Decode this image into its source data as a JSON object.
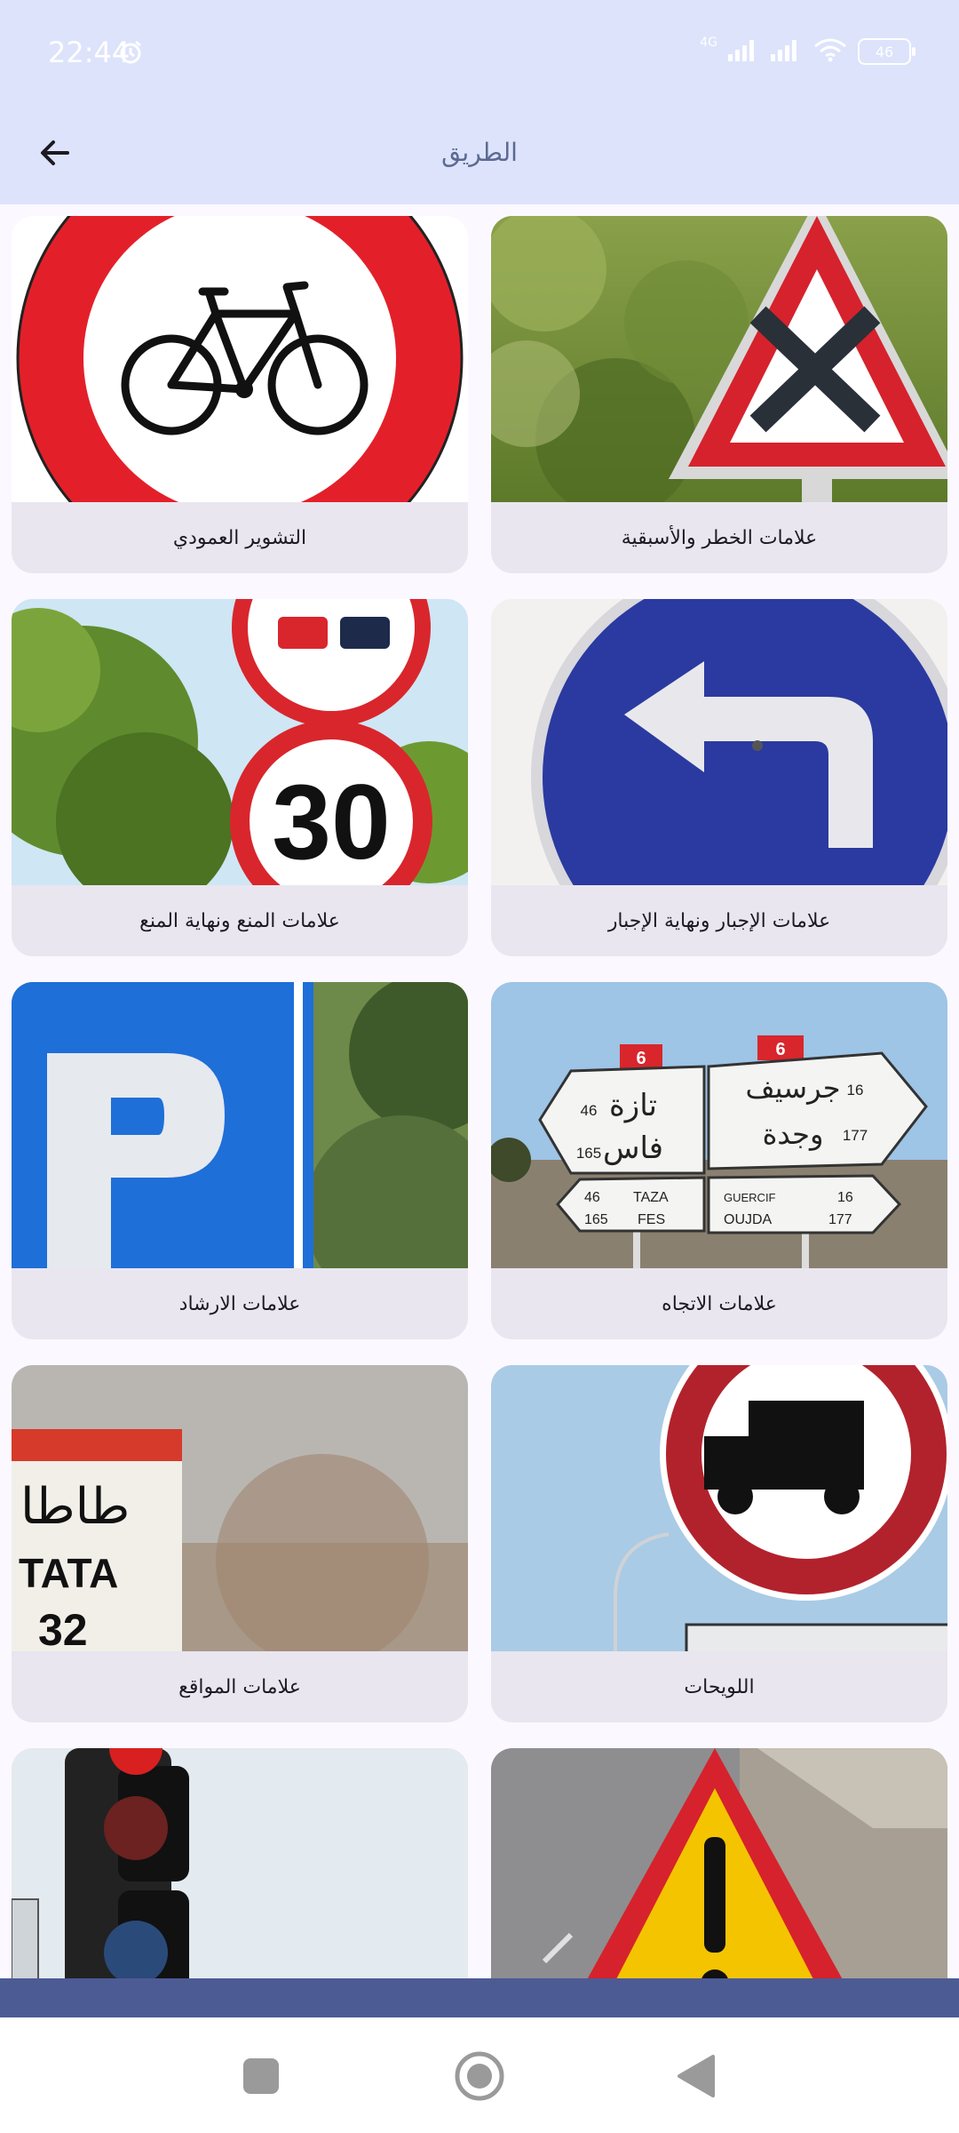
{
  "status_bar": {
    "time": "22:44",
    "network_label": "4G",
    "battery": "46"
  },
  "app_bar": {
    "title": "الطريق"
  },
  "cards": [
    {
      "label": "التشوير العمودي",
      "image": "no-bicycles-sign"
    },
    {
      "label": "علامات الخطر والأسبقية",
      "image": "crossroads-priority-sign"
    },
    {
      "label": "علامات المنع ونهاية المنع",
      "image": "no-overtaking-and-speed-30-signs"
    },
    {
      "label": "علامات الإجبار ونهاية الإجبار",
      "image": "mandatory-turn-left-sign"
    },
    {
      "label": "علامات الارشاد",
      "image": "parking-sign"
    },
    {
      "label": "علامات الاتجاه",
      "image": "direction-signposts"
    },
    {
      "label": "علامات المواقع",
      "image": "location-milestone"
    },
    {
      "label": "اللويحات",
      "image": "no-trucks-sign-with-panel"
    },
    {
      "label": "",
      "image": "traffic-light"
    },
    {
      "label": "",
      "image": "warning-exclamation-sign"
    }
  ],
  "images_text": {
    "speed": "30",
    "dir_route": "6",
    "dir_city_taza_ar": "تازة",
    "dir_city_fes_ar": "فاس",
    "dir_city_guercif_ar": "جرسيف",
    "dir_city_oujda_ar": "وجدة",
    "dir_km_taza": "46",
    "dir_km_fes": "165",
    "dir_km_guercif": "16",
    "dir_km_oujda": "177",
    "dir_taza": "TAZA",
    "dir_fes": "FES",
    "dir_guercif": "GUERCIF",
    "dir_oujda": "OUJDA",
    "milestone_ar": "طاطا",
    "milestone_name": "TATA",
    "milestone_km": "32"
  },
  "nav": {
    "recent": "square-icon",
    "home": "circle-icon",
    "back": "triangle-back-icon"
  },
  "colors": {
    "app_bar": "#dde3fb",
    "card": "#e9e6ef",
    "bottom_bar": "#4c5b94",
    "sign_red": "#e3202a",
    "sign_blue": "#2b3aa0"
  }
}
